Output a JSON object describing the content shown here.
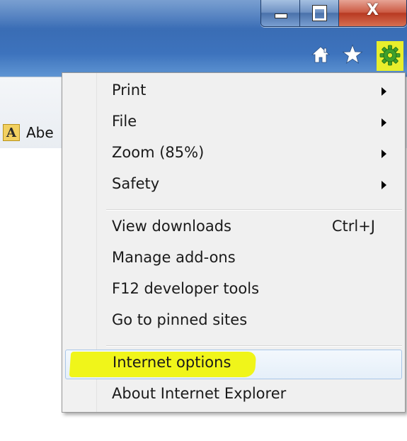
{
  "window": {
    "close_glyph": "X",
    "accent_blue": "#3d73bd",
    "close_red": "#c44a32"
  },
  "toolbar": {
    "icons": [
      "home-icon",
      "star-icon",
      "gear-icon"
    ],
    "gear_highlight_color": "#e8ee2c"
  },
  "favorites": {
    "icon_glyph": "A",
    "label": "Abe"
  },
  "menu": {
    "items": [
      {
        "label": "Print",
        "submenu": true
      },
      {
        "label": "File",
        "submenu": true
      },
      {
        "label": "Zoom (85%)",
        "submenu": true
      },
      {
        "label": "Safety",
        "submenu": true
      },
      {
        "label": "View downloads",
        "shortcut": "Ctrl+J"
      },
      {
        "label": "Manage add-ons"
      },
      {
        "label": "F12 developer tools"
      },
      {
        "label": "Go to pinned sites"
      },
      {
        "label": "Internet options",
        "highlighted": true
      },
      {
        "label": "About Internet Explorer"
      }
    ],
    "highlight_color": "#f0f51a"
  }
}
